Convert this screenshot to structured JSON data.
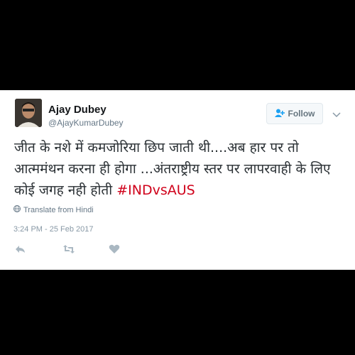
{
  "tweet": {
    "user": {
      "name": "Ajay Dubey",
      "handle": "@AjayKumarDubey"
    },
    "follow_label": "Follow",
    "text": "जीत के नशे में कमजोरिया छिप जाती थी....अब हार पर तो आत्ममंथन करना ही होगा ...अंतराष्ट्रीय स्तर पर लापरवाही के लिए कोई जगह नही होती ",
    "hashtag": "#INDvsAUS",
    "translate_label": "Translate from Hindi",
    "timestamp": "3:24 PM - 25 Feb 2017"
  },
  "icons": {
    "follow": "add-person-icon",
    "menu": "chevron-down-icon",
    "translate": "globe-icon",
    "reply": "reply-icon",
    "retweet": "retweet-icon",
    "like": "heart-icon"
  },
  "colors": {
    "hashtag": "#d0021b",
    "background": "#000000",
    "card": "#ffffff"
  }
}
